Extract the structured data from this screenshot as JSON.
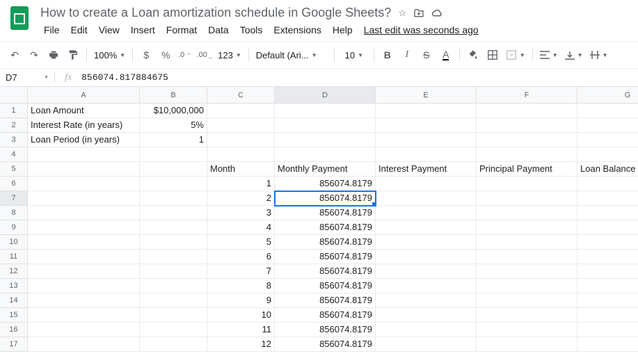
{
  "doc": {
    "title": "How to create a Loan amortization schedule in Google Sheets?"
  },
  "menu": {
    "file": "File",
    "edit": "Edit",
    "view": "View",
    "insert": "Insert",
    "format": "Format",
    "data": "Data",
    "tools": "Tools",
    "extensions": "Extensions",
    "help": "Help",
    "lastEdit": "Last edit was seconds ago"
  },
  "toolbar": {
    "zoom": "100%",
    "currency": "$",
    "percent": "%",
    "dec1": ".0",
    "dec2": ".00",
    "fmt": "123",
    "font": "Default (Ari...",
    "size": "10",
    "bold": "B",
    "italic": "I",
    "strike": "S",
    "textcolor": "A"
  },
  "formula": {
    "cell": "D7",
    "fx": "fx",
    "value": "856074.817884675"
  },
  "cols": [
    "A",
    "B",
    "C",
    "D",
    "E",
    "F",
    "G"
  ],
  "rowCount": 17,
  "selectedRow": 7,
  "selectedCol": "D",
  "labels": {
    "loanAmount": "Loan Amount",
    "loanAmountVal": "$10,000,000",
    "interestRate": "Interest Rate (in years)",
    "interestRateVal": "5%",
    "loanPeriod": "Loan Period (in years)",
    "loanPeriodVal": "1",
    "month": "Month",
    "monthlyPayment": "Monthly Payment",
    "interestPayment": "Interest Payment",
    "principalPayment": "Principal Payment",
    "loanBalance": "Loan Balance"
  },
  "chart_data": {
    "type": "table",
    "title": "Loan amortization schedule",
    "columns": [
      "Month",
      "Monthly Payment",
      "Interest Payment",
      "Principal Payment",
      "Loan Balance"
    ],
    "rows": [
      {
        "month": 1,
        "monthly_payment": 856074.8179
      },
      {
        "month": 2,
        "monthly_payment": 856074.8179
      },
      {
        "month": 3,
        "monthly_payment": 856074.8179
      },
      {
        "month": 4,
        "monthly_payment": 856074.8179
      },
      {
        "month": 5,
        "monthly_payment": 856074.8179
      },
      {
        "month": 6,
        "monthly_payment": 856074.8179
      },
      {
        "month": 7,
        "monthly_payment": 856074.8179
      },
      {
        "month": 8,
        "monthly_payment": 856074.8179
      },
      {
        "month": 9,
        "monthly_payment": 856074.8179
      },
      {
        "month": 10,
        "monthly_payment": 856074.8179
      },
      {
        "month": 11,
        "monthly_payment": 856074.8179
      },
      {
        "month": 12,
        "monthly_payment": 856074.8179
      }
    ]
  }
}
